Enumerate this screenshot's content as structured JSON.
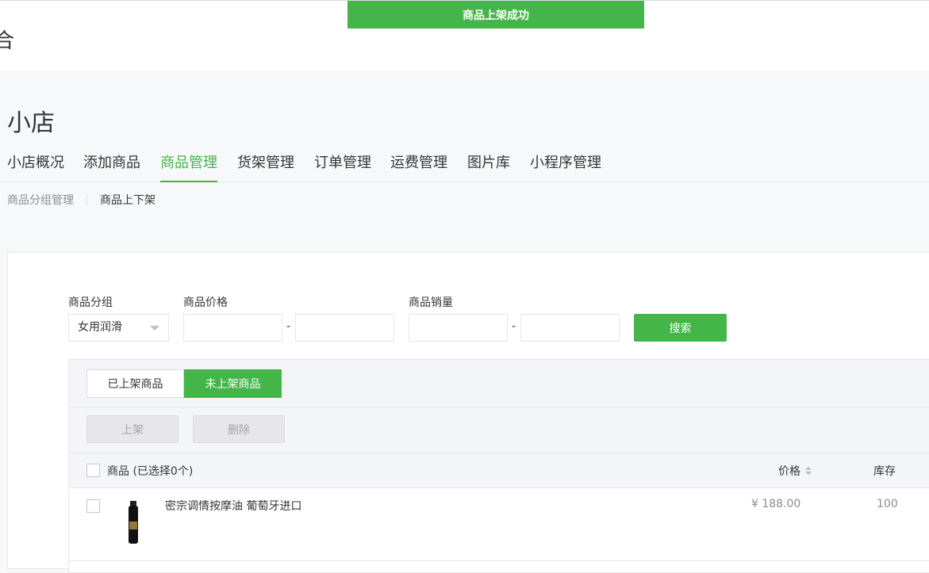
{
  "header": {
    "fragment": "合"
  },
  "toast": {
    "message": "商品上架成功"
  },
  "shop": {
    "title": "小店"
  },
  "main_tabs": [
    {
      "label": "小店概况"
    },
    {
      "label": "添加商品"
    },
    {
      "label": "商品管理",
      "active": true
    },
    {
      "label": "货架管理"
    },
    {
      "label": "订单管理"
    },
    {
      "label": "运费管理"
    },
    {
      "label": "图片库"
    },
    {
      "label": "小程序管理"
    }
  ],
  "sub_nav": [
    {
      "label": "商品分组管理"
    },
    {
      "label": "商品上下架",
      "active": true
    }
  ],
  "filters": {
    "group_label": "商品分组",
    "group_value": "女用润滑",
    "price_label": "商品价格",
    "sales_label": "商品销量",
    "range_separator": "-",
    "search_label": "搜索"
  },
  "segment": {
    "listed": "已上架商品",
    "unlisted": "未上架商品",
    "active": "unlisted"
  },
  "actions": {
    "list": "上架",
    "delete": "删除"
  },
  "table": {
    "col_product": "商品 (已选择0个)",
    "col_price": "价格",
    "col_stock": "库存",
    "rows": [
      {
        "name": "密宗调情按摩油 葡萄牙进口",
        "price": "¥ 188.00",
        "stock": "100"
      }
    ]
  },
  "colors": {
    "accent": "#44b549",
    "background": "#f6f8f9"
  }
}
